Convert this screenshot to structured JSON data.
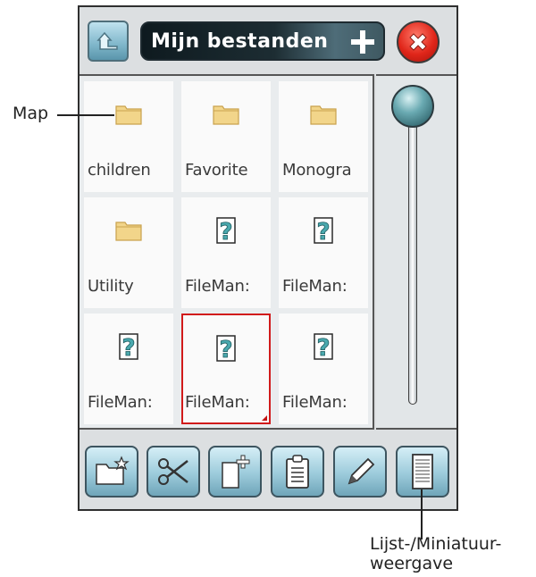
{
  "window": {
    "title": "Mijn bestanden"
  },
  "files": [
    {
      "label": "children",
      "type": "folder"
    },
    {
      "label": "Favorite",
      "type": "folder"
    },
    {
      "label": "Monogra",
      "type": "folder"
    },
    {
      "label": "Utility",
      "type": "folder"
    },
    {
      "label": "FileMan:",
      "type": "unknown"
    },
    {
      "label": "FileMan:",
      "type": "unknown"
    },
    {
      "label": "FileMan:",
      "type": "unknown"
    },
    {
      "label": "FileMan:",
      "type": "unknown",
      "selected": true
    },
    {
      "label": "FileMan:",
      "type": "unknown"
    }
  ],
  "toolbar": {
    "buttons": [
      {
        "name": "new-folder-icon"
      },
      {
        "name": "scissors-icon"
      },
      {
        "name": "new-file-icon"
      },
      {
        "name": "clipboard-icon"
      },
      {
        "name": "pencil-icon"
      },
      {
        "name": "list-view-icon"
      }
    ]
  },
  "callouts": {
    "map": "Map",
    "view_line1": "Lijst-/Miniatuur-",
    "view_line2": "weergave"
  },
  "colors": {
    "folder": "#f2d58a",
    "unknown_icon": "#4aa9ae",
    "selection": "#d11a1a",
    "close": "#e0261a"
  }
}
